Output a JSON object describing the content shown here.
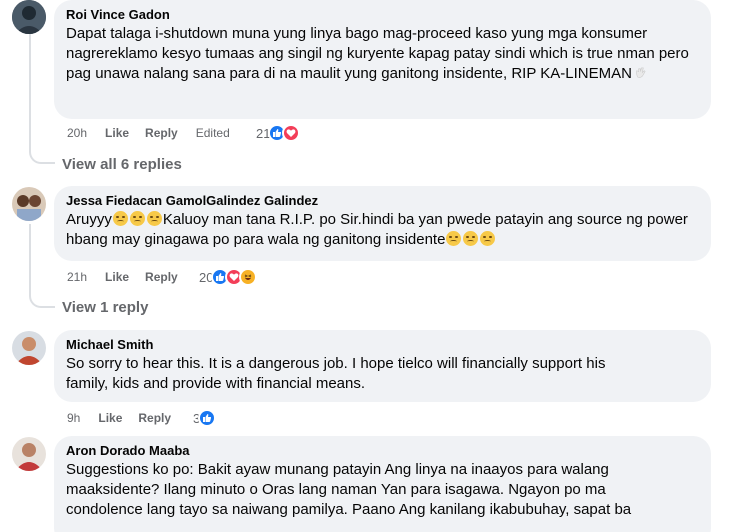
{
  "comments": [
    {
      "author": "Roi Vince Gadon",
      "text": "Dapat talaga i-shutdown muna yung linya bago mag-proceed kaso yung mga konsumer nagrereklamo kesyo tumaas ang singil ng kuryente kapag patay sindi which is true nman pero pag unawa nalang sana para di na maulit yung ganitong insidente, RIP KA-LINEMAN",
      "time": "20h",
      "like": "Like",
      "reply": "Reply",
      "edited": "Edited",
      "reaction_count": "21",
      "reactions": [
        "like-icon",
        "love-icon"
      ]
    },
    {
      "author": "Jessa Fiedacan GamolGalindez Galindez",
      "text_start": "Aruyyy",
      "text_mid": "Kaluoy man tana R.I.P. po Sir.hindi ba yan pwede patayin ang source ng power hbang may ginagawa po para wala ng ganitong insidente",
      "time": "21h",
      "like": "Like",
      "reply": "Reply",
      "reaction_count": "20",
      "reactions": [
        "like-icon",
        "love-icon",
        "haha-icon"
      ]
    },
    {
      "author": "Michael Smith",
      "text": "So sorry to hear this. It is a dangerous job. I hope tielco will financially support his family, kids and provide with financial means.",
      "time": "9h",
      "like": "Like",
      "reply": "Reply",
      "reaction_count": "3",
      "reactions": [
        "like-icon"
      ]
    },
    {
      "author": "Aron Dorado Maaba",
      "text": "Suggestions ko po: Bakit ayaw munang patayin Ang linya na inaayos para walang maaksidente? Ilang minuto o Oras lang naman Yan para isagawa. Ngayon po ma condolence lang tayo sa naiwang pamilya. Paano Ang kanilang ikabubuhay, sapat ba"
    }
  ],
  "view_replies": [
    "View all 6 replies",
    "View 1 reply"
  ],
  "colors": {
    "bubble": "#f0f2f5",
    "meta": "#65676b",
    "like": "#1877f2",
    "love": "#f33e58",
    "haha": "#f7b125"
  }
}
